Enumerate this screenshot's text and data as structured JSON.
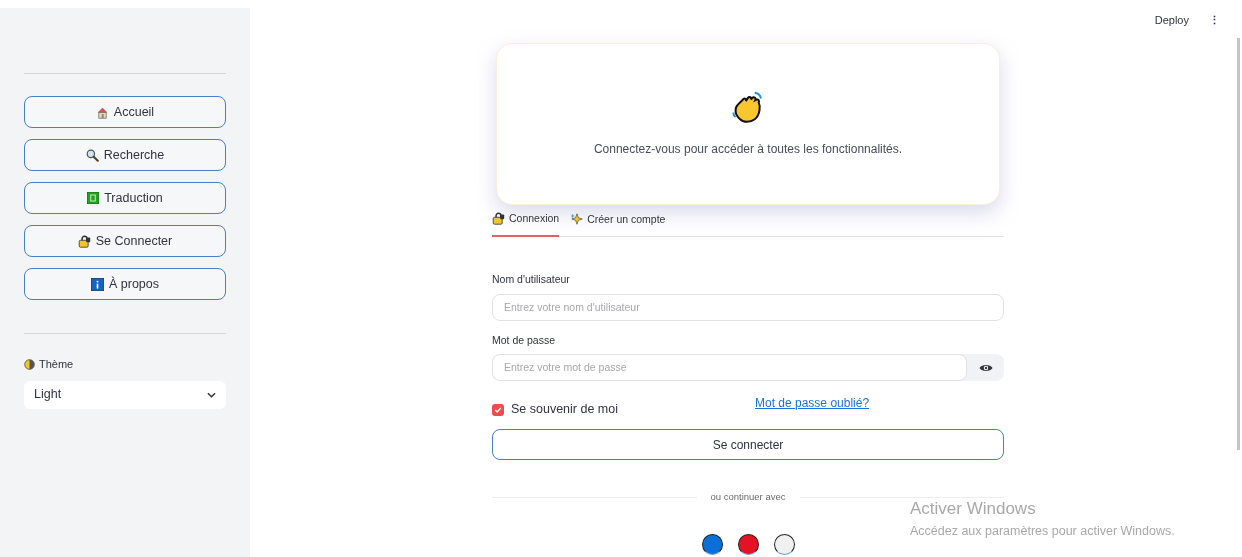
{
  "header": {
    "deploy": "Deploy",
    "menu": "⋮"
  },
  "sidebar": {
    "nav": [
      {
        "label": "Accueil",
        "kind": "house"
      },
      {
        "label": "Recherche",
        "kind": "search"
      },
      {
        "label": "Traduction",
        "kind": "translate"
      },
      {
        "label": "Se Connecter",
        "kind": "lock"
      },
      {
        "label": "À propos",
        "kind": "info"
      }
    ],
    "theme": {
      "label": "Thème",
      "value": "Light"
    }
  },
  "welcome": {
    "message": "Connectez-vous pour accéder à toutes les fonctionnalités."
  },
  "tabs": [
    {
      "label": "Connexion",
      "kind": "lock",
      "selected": true
    },
    {
      "label": "Créer un compte",
      "kind": "sparkles",
      "selected": false
    }
  ],
  "form": {
    "username": {
      "label": "Nom d'utilisateur",
      "placeholder": "Entrez votre nom d'utilisateur"
    },
    "password": {
      "label": "Mot de passe",
      "placeholder": "Entrez votre mot de passe"
    },
    "remember": {
      "label": "Se souvenir de moi",
      "checked": true
    },
    "forgot": "Mot de passe oublié?",
    "submit": "Se connecter",
    "divider": "ou continuer avec",
    "social": [
      {
        "color": "#0a6fd6"
      },
      {
        "color": "#e31224"
      },
      {
        "color": "#f0f0f0"
      }
    ]
  },
  "windows_activation": {
    "title": "Activer Windows",
    "message": "Accédez aux paramètres pour activer Windows."
  }
}
